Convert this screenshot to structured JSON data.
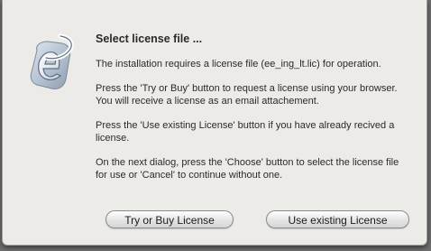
{
  "dialog": {
    "title": "Select license file  ...",
    "paragraphs": [
      "The installation requires a license file (ee_ing_lt.lic) for operation.",
      "Press the 'Try or Buy' button to request a license using your browser. You will receive a license as an email attachement.",
      "Press the 'Use existing License' button if you have already recived a license.",
      "On the next dialog, press the 'Choose' button to select the license file for use or 'Cancel' to continue without one."
    ],
    "buttons": {
      "try_or_buy": "Try or Buy License",
      "use_existing": "Use existing License"
    }
  },
  "icon": {
    "name": "application-e-logo-icon",
    "colors": {
      "swoosh_light": "#eef2f6",
      "swoosh_dark": "#5f6f82",
      "plate": "#b6c3d1"
    }
  }
}
